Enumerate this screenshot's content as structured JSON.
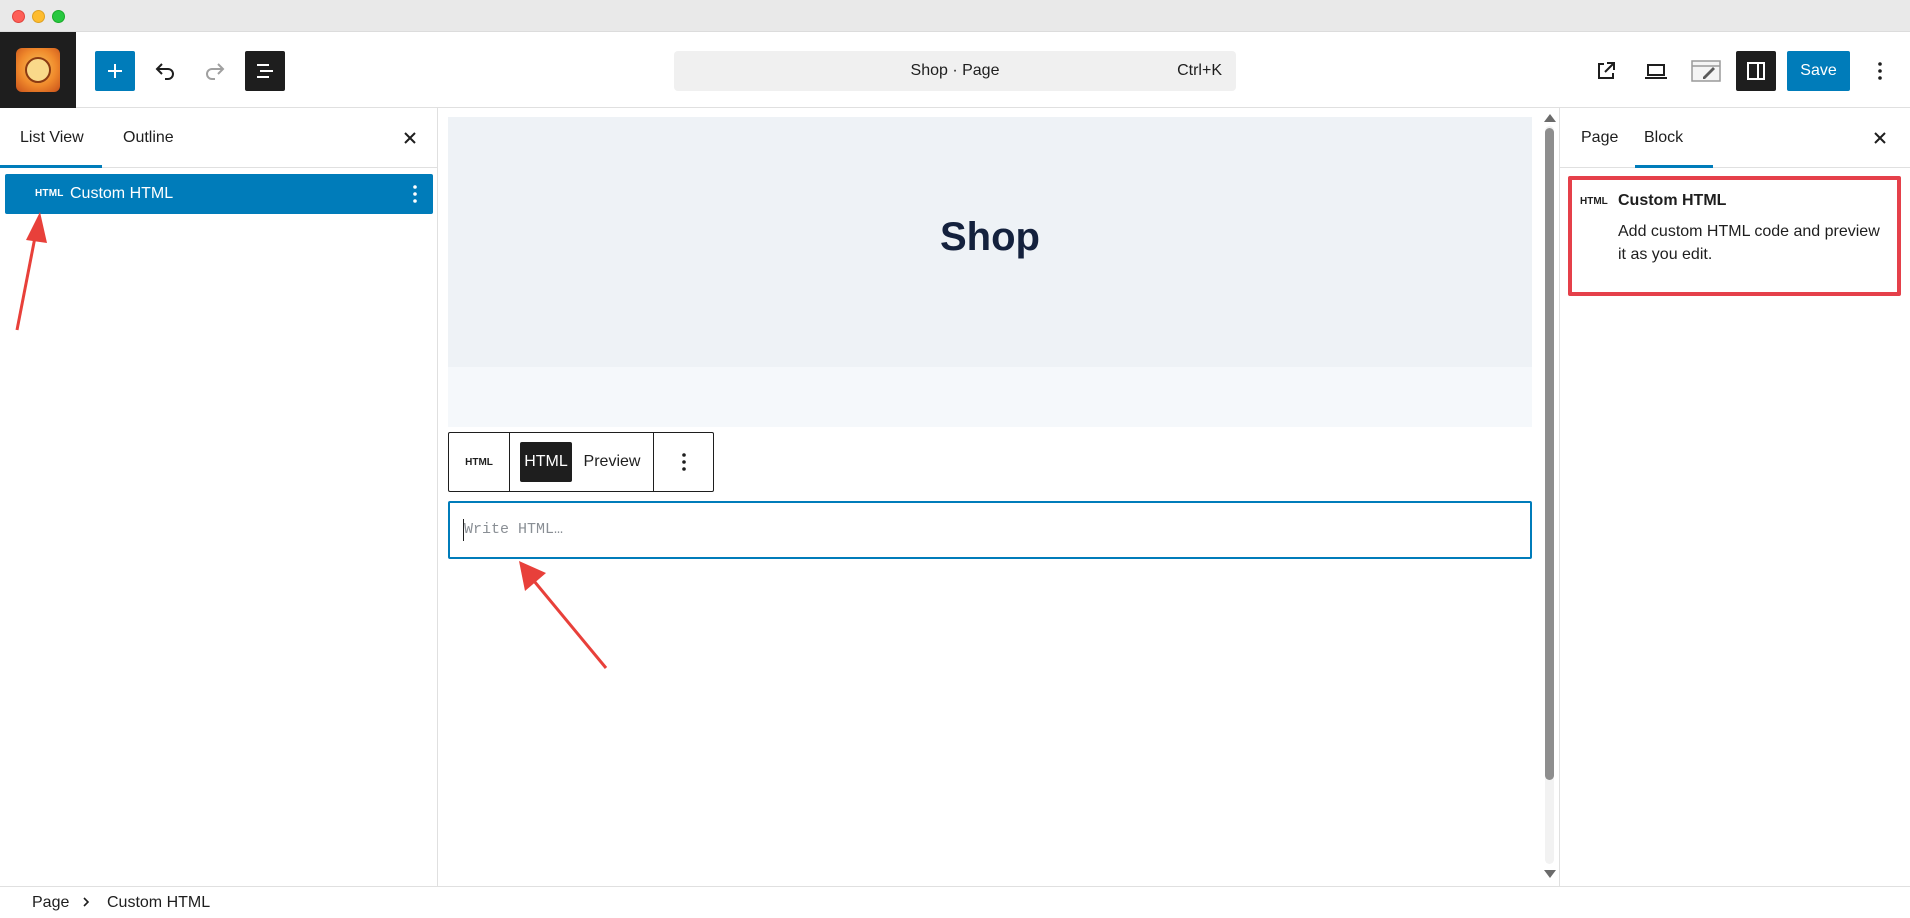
{
  "toolbar": {
    "command_title": "Shop · Page",
    "command_shortcut": "Ctrl+K",
    "save_label": "Save"
  },
  "left_panel": {
    "tabs": [
      {
        "label": "List View"
      },
      {
        "label": "Outline"
      }
    ],
    "items": [
      {
        "icon_text": "HTML",
        "label": "Custom HTML"
      }
    ]
  },
  "canvas": {
    "page_title": "Shop",
    "block_toolbar": {
      "type_icon_text": "HTML",
      "html_label": "HTML",
      "preview_label": "Preview"
    },
    "html_input": {
      "value": "",
      "placeholder": "Write HTML…"
    }
  },
  "right_panel": {
    "tabs": [
      {
        "label": "Page"
      },
      {
        "label": "Block"
      }
    ],
    "block_card": {
      "icon_text": "HTML",
      "title": "Custom HTML",
      "description": "Add custom HTML code and preview it as you edit."
    }
  },
  "footer": {
    "breadcrumbs": [
      {
        "label": "Page"
      },
      {
        "label": "Custom HTML"
      }
    ]
  },
  "colors": {
    "accent": "#007cba",
    "highlight": "#e5404a",
    "dark": "#1e1e1e"
  },
  "icons": {
    "add": "plus-icon",
    "undo": "undo-icon",
    "redo": "redo-icon",
    "list_view": "list-view-icon",
    "view": "external-link-icon",
    "device": "laptop-icon",
    "styles": "styles-icon",
    "settings": "sidebar-icon",
    "more": "more-vertical-icon",
    "close": "close-icon"
  }
}
